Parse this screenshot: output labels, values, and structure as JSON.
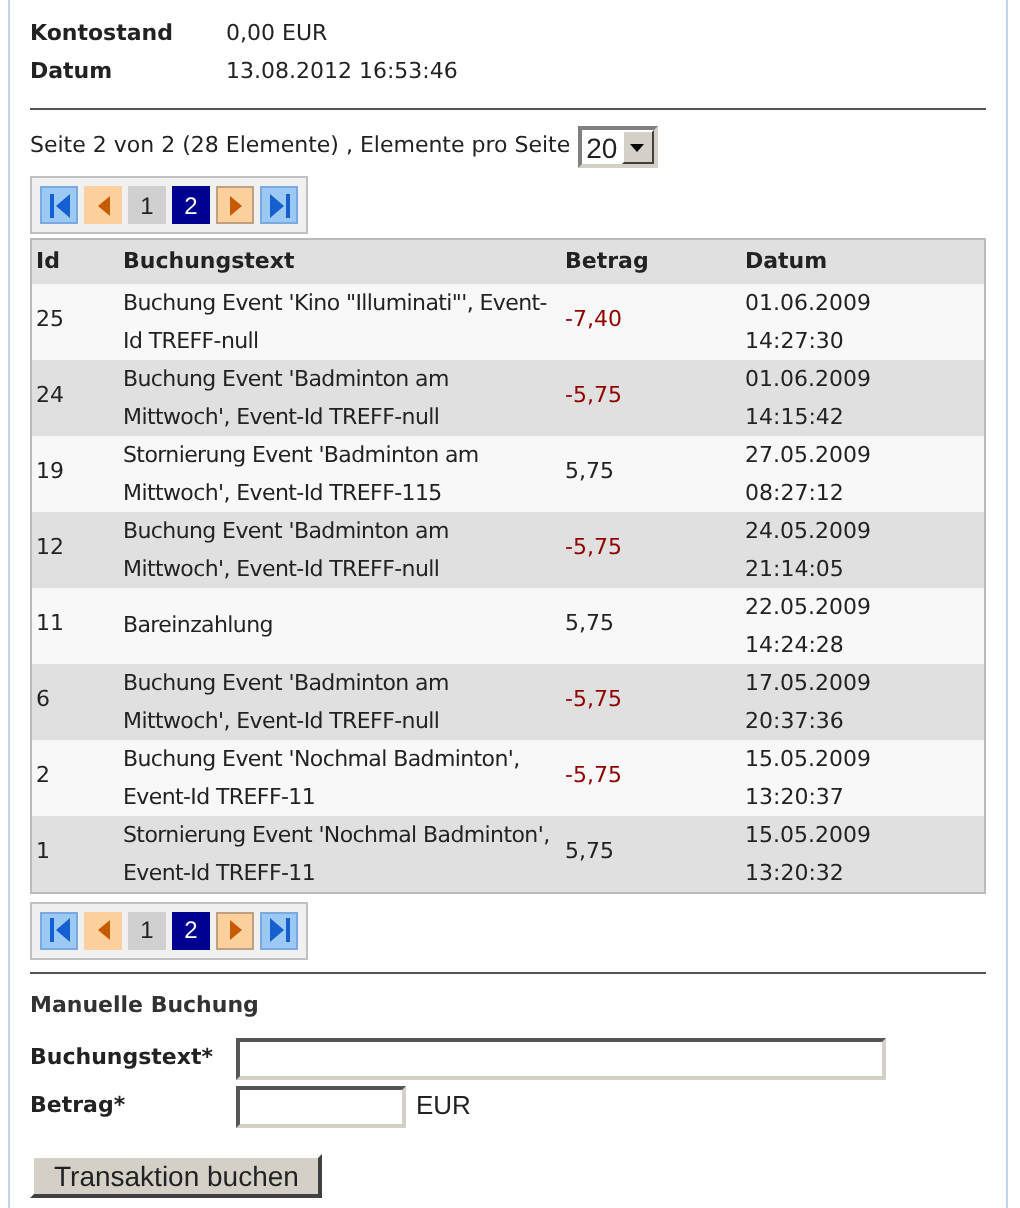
{
  "summary": [
    {
      "label": "Kontostand",
      "value": "0,00 EUR"
    },
    {
      "label": "Datum",
      "value": "13.08.2012 16:53:46"
    }
  ],
  "paging_info": "Seite 2 von 2 (28 Elemente) , Elemente pro Seite",
  "page_size": {
    "value": "20"
  },
  "pagers": [
    {
      "buttons": [
        {
          "kind": "first"
        },
        {
          "kind": "prev"
        },
        {
          "kind": "page",
          "label": "1",
          "selected": false
        },
        {
          "kind": "page",
          "label": "2",
          "selected": true
        },
        {
          "kind": "next"
        },
        {
          "kind": "last"
        }
      ]
    },
    {
      "buttons": [
        {
          "kind": "first"
        },
        {
          "kind": "prev"
        },
        {
          "kind": "page",
          "label": "1",
          "selected": false
        },
        {
          "kind": "page",
          "label": "2",
          "selected": true
        },
        {
          "kind": "next"
        },
        {
          "kind": "last"
        }
      ]
    }
  ],
  "table": {
    "columns": [
      "Id",
      "Buchungstext",
      "Betrag",
      "Datum"
    ],
    "rows": [
      {
        "id": "25",
        "text": "Buchung Event 'Kino \"Illuminati\"', Event-Id TREFF-null",
        "amount": "-7,40",
        "negative": true,
        "date": "01.06.2009",
        "time": "14:27:30"
      },
      {
        "id": "24",
        "text": "Buchung Event 'Badminton am Mittwoch', Event-Id TREFF-null",
        "amount": "-5,75",
        "negative": true,
        "date": "01.06.2009",
        "time": "14:15:42"
      },
      {
        "id": "19",
        "text": "Stornierung Event 'Badminton am Mittwoch', Event-Id TREFF-115",
        "amount": "5,75",
        "negative": false,
        "date": "27.05.2009",
        "time": "08:27:12"
      },
      {
        "id": "12",
        "text": "Buchung Event 'Badminton am Mittwoch', Event-Id TREFF-null",
        "amount": "-5,75",
        "negative": true,
        "date": "24.05.2009",
        "time": "21:14:05"
      },
      {
        "id": "11",
        "text": "Bareinzahlung",
        "amount": "5,75",
        "negative": false,
        "date": "22.05.2009",
        "time": "14:24:28"
      },
      {
        "id": "6",
        "text": "Buchung Event 'Badminton am Mittwoch', Event-Id TREFF-null",
        "amount": "-5,75",
        "negative": true,
        "date": "17.05.2009",
        "time": "20:37:36"
      },
      {
        "id": "2",
        "text": "Buchung Event 'Nochmal Badminton', Event-Id TREFF-11",
        "amount": "-5,75",
        "negative": true,
        "date": "15.05.2009",
        "time": "13:20:37"
      },
      {
        "id": "1",
        "text": "Stornierung Event 'Nochmal Badminton', Event-Id TREFF-11",
        "amount": "5,75",
        "negative": false,
        "date": "15.05.2009",
        "time": "13:20:32"
      }
    ]
  },
  "manual_booking": {
    "title": "Manuelle Buchung",
    "fields": [
      {
        "label": "Buchungstext*",
        "wide": true
      },
      {
        "label": "Betrag*",
        "wide": false,
        "unit": "EUR"
      }
    ],
    "submit": "Transaktion buchen"
  }
}
